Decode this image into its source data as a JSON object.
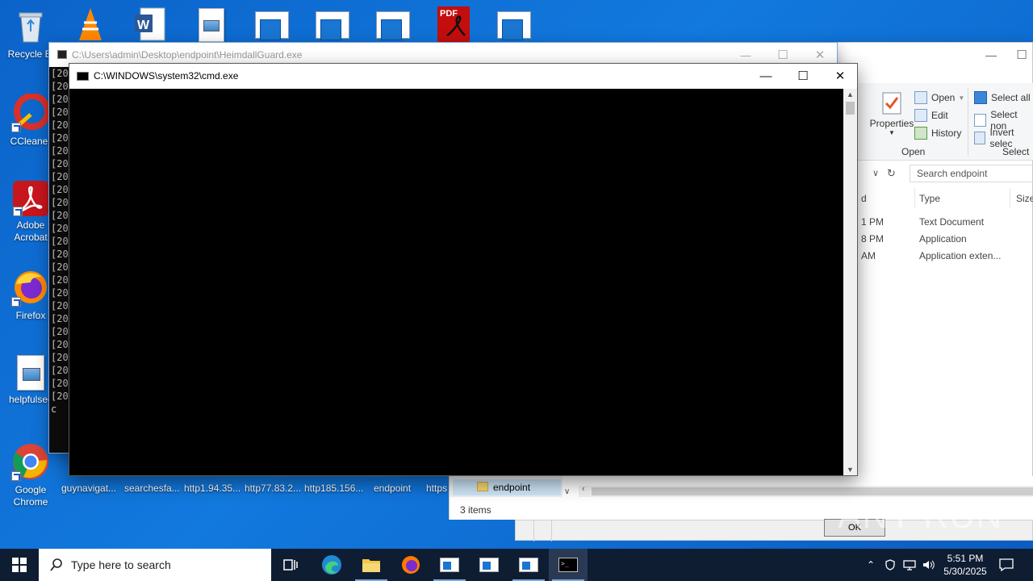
{
  "desktop_icons": [
    {
      "label": "Recycle Bi"
    },
    {
      "label": "CCleaner"
    },
    {
      "label": "Adobe Acrobat"
    },
    {
      "label": "Firefox"
    },
    {
      "label": "helpfulsec"
    },
    {
      "label": "Google Chrome"
    }
  ],
  "bottom_icons": [
    "guynavigat...",
    "searchesfa...",
    "http1.94.35...",
    "http77.83.2...",
    "http185.156...",
    "endpoint",
    "https"
  ],
  "heimdall_window": {
    "title": "C:\\Users\\admin\\Desktop\\endpoint\\HeimdallGuard.exe",
    "console_prefix": "[20",
    "console_tail": "c"
  },
  "cmd_window": {
    "title": "C:\\WINDOWS\\system32\\cmd.exe"
  },
  "explorer": {
    "ribbon": {
      "properties": "Properties",
      "open": "Open",
      "edit": "Edit",
      "history": "History",
      "open_group": "Open",
      "select_all": "Select all",
      "select_none": "Select non",
      "invert_selection": "Invert selec",
      "select_group": "Select"
    },
    "search_placeholder": "Search endpoint",
    "columns": {
      "date_fragment": "d",
      "type": "Type",
      "size": "Size"
    },
    "rows": [
      {
        "time": "1 PM",
        "type": "Text Document"
      },
      {
        "time": "8 PM",
        "type": "Application"
      },
      {
        "time": "AM",
        "type": "Application exten..."
      }
    ],
    "nav_item": "endpoint",
    "status": "3 items"
  },
  "dialog": {
    "ok_label": "OK"
  },
  "watermark": "ANY RUN",
  "taskbar": {
    "search_placeholder": "Type here to search",
    "time": "5:51 PM",
    "date": "5/30/2025"
  },
  "colors": {
    "desktop": "#0b63c9",
    "taskbar": "#0f1d33",
    "console": "#000000"
  }
}
